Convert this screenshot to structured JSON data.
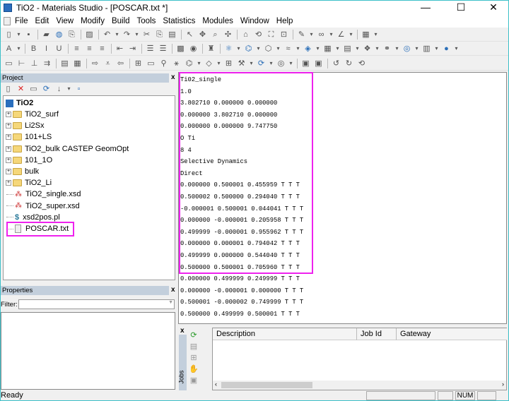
{
  "window": {
    "title": "TiO2 - Materials Studio - [POSCAR.txt *]",
    "minimize": "—",
    "maximize": "☐",
    "close": "✕"
  },
  "menu": [
    "File",
    "Edit",
    "View",
    "Modify",
    "Build",
    "Tools",
    "Statistics",
    "Modules",
    "Window",
    "Help"
  ],
  "toolbars": [
    [
      "new-file",
      "dropdown",
      "save",
      "|",
      "open-project",
      "web-open",
      "import",
      "|",
      "print",
      "|",
      "undo",
      "dropdown",
      "redo",
      "dropdown",
      "cut",
      "copy",
      "paste",
      "|",
      "select",
      "move",
      "zoom",
      "translate",
      "|",
      "home",
      "rotate",
      "fit",
      "reset",
      "|",
      "pen",
      "dropdown",
      "lasso",
      "dropdown",
      "measure",
      "dropdown",
      "|",
      "grid",
      "dropdown"
    ],
    [
      "font",
      "dropdown",
      "|",
      "bold",
      "italic",
      "underline",
      "|",
      "align-left",
      "align-center",
      "align-right",
      "|",
      "indent-less",
      "indent-more",
      "|",
      "numbered-list",
      "bullet-list",
      "|",
      "image",
      "globe",
      "|",
      "find",
      "|",
      "atom-build",
      "dropdown",
      "bond",
      "dropdown",
      "ring",
      "dropdown",
      "chain",
      "dropdown",
      "crystal",
      "dropdown",
      "surface",
      "dropdown",
      "layer",
      "dropdown",
      "cluster",
      "dropdown",
      "polymer",
      "dropdown",
      "nano",
      "dropdown",
      "mesh",
      "dropdown",
      "sphere",
      "dropdown"
    ],
    [
      "window-layout",
      "tree-view",
      "hierarchy",
      "connect",
      "|",
      "table",
      "table-grid",
      "|",
      "export",
      "filter",
      "import-data",
      "|",
      "chart-a",
      "chart-b",
      "molecule-a",
      "molecule-b",
      "molecule-c",
      "dropdown",
      "tag",
      "dropdown",
      "grid-3d",
      "wrench",
      "dropdown",
      "refresh",
      "dropdown",
      "target",
      "dropdown",
      "|",
      "cube",
      "cube-2",
      "|",
      "rotate-left",
      "rotate-right",
      "rotate-3d"
    ]
  ],
  "project": {
    "header": "Project",
    "close": "x",
    "toolbar": [
      "new-item",
      "delete",
      "properties",
      "refresh",
      "sort-az",
      "dropdown",
      "library"
    ],
    "root": "TiO2",
    "items": [
      {
        "label": "TiO2_surf",
        "type": "folder"
      },
      {
        "label": "Li2Sx",
        "type": "folder"
      },
      {
        "label": "101+LS",
        "type": "folder"
      },
      {
        "label": "TiO2_bulk CASTEP GeomOpt",
        "type": "folder"
      },
      {
        "label": "101_1O",
        "type": "folder"
      },
      {
        "label": "bulk",
        "type": "folder"
      },
      {
        "label": "TiO2_Li",
        "type": "folder"
      },
      {
        "label": "TiO2_single.xsd",
        "type": "structure"
      },
      {
        "label": "TiO2_super.xsd",
        "type": "structure"
      },
      {
        "label": "xsd2pos.pl",
        "type": "script"
      },
      {
        "label": "POSCAR.txt",
        "type": "text"
      }
    ]
  },
  "editor": {
    "lines": [
      "Ti02_single",
      "1.0",
      "3.802710 0.000000 0.000000",
      "0.000000 3.802710 0.000000",
      "0.000000 0.000000 9.747750",
      "O Ti",
      "8 4",
      "Selective Dynamics",
      "Direct",
      "0.000000 0.500001 0.455959 T T T",
      "0.500002 0.500000 0.294040 T T T",
      "-0.000001 0.500001 0.044041 T T T",
      "0.000000 -0.000001 0.205958 T T T",
      "0.499999 -0.000001 0.955962 T T T",
      "0.000000 0.000001 0.794042 T T T",
      "0.499999 0.000000 0.544040 T T T",
      "0.500000 0.500001 0.705960 T T T",
      "0.000000 0.499999 0.249999 T T T",
      "0.000000 -0.000001 0.000000 T T T",
      "0.500001 -0.000002 0.749999 T T T",
      "0.500000 0.499999 0.500001 T T T"
    ]
  },
  "properties": {
    "header": "Properties",
    "close": "x",
    "filter_label": "Filter:",
    "filter_value": ""
  },
  "jobs": {
    "tab": "Jobs",
    "close": "x",
    "columns": [
      "Description",
      "Job Id",
      "Gateway"
    ]
  },
  "status": {
    "text": "Ready",
    "num": "NUM"
  }
}
